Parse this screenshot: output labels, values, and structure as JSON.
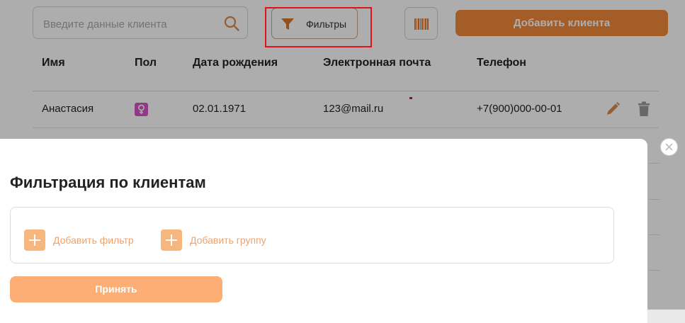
{
  "toolbar": {
    "search_placeholder": "Введите данные клиента",
    "filter_label": "Фильтры",
    "add_client_label": "Добавить клиента"
  },
  "table": {
    "headers": [
      "Имя",
      "Пол",
      "Дата рождения",
      "Электронная почта",
      "Телефон"
    ],
    "rows": [
      {
        "name": "Анастасия",
        "gender": "female-icon",
        "birth_date": "02.01.1971",
        "email": "123@mail.ru",
        "phone": "+7(900)000-00-01"
      }
    ]
  },
  "modal": {
    "title": "Фильтрация по клиентам",
    "add_filter_label": "Добавить фильтр",
    "add_group_label": "Добавить группу",
    "apply_label": "Принять"
  },
  "colors": {
    "accent": "#f3893a",
    "accent_light": "#fcae74",
    "highlight": "#e0131c",
    "female_badge": "#d654c8"
  }
}
